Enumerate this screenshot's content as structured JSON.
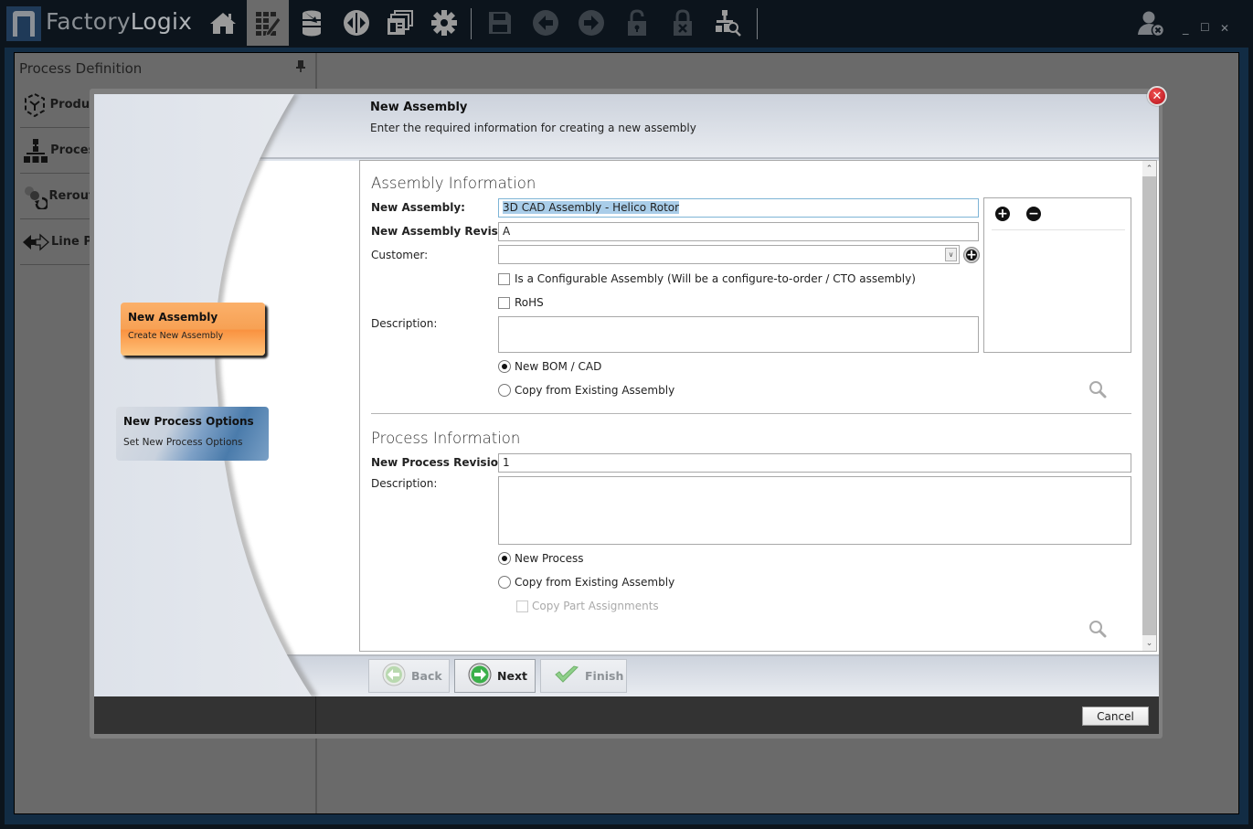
{
  "app": {
    "logo_text_plain": "Factory",
    "logo_text_bold": "Logix",
    "toolbar_icons": [
      {
        "name": "home-icon",
        "active": false,
        "enabled": true
      },
      {
        "name": "process-editor-grid-icon",
        "active": true,
        "enabled": true
      },
      {
        "name": "database-import-icon",
        "active": false,
        "enabled": true
      },
      {
        "name": "navigation-arrows-icon",
        "active": false,
        "enabled": true
      },
      {
        "name": "windows-icon",
        "active": false,
        "enabled": true
      },
      {
        "name": "gear-icon",
        "active": false,
        "enabled": true
      },
      {
        "name": "save-icon",
        "active": false,
        "enabled": false
      },
      {
        "name": "back-arrow-icon",
        "active": false,
        "enabled": false
      },
      {
        "name": "forward-arrow-icon",
        "active": false,
        "enabled": false
      },
      {
        "name": "unlock-icon",
        "active": false,
        "enabled": false
      },
      {
        "name": "lock-cancel-icon",
        "active": false,
        "enabled": false
      },
      {
        "name": "hierarchy-search-icon",
        "active": false,
        "enabled": true
      }
    ],
    "window_controls": {
      "minimize": "_",
      "maximize": "☐",
      "close": "✕"
    }
  },
  "process_definition": {
    "title": "Process Definition",
    "items": [
      {
        "label": "Product",
        "icon": "product-cube-icon"
      },
      {
        "label": "Process",
        "icon": "process-hierarchy-icon"
      },
      {
        "label": "Reroute",
        "icon": "reroute-icon"
      },
      {
        "label": "Line Pr",
        "icon": "line-arrows-icon"
      }
    ]
  },
  "dialog": {
    "header_title": "New Assembly",
    "header_subtitle": "Enter the required information for creating a new assembly",
    "steps": [
      {
        "title": "New Assembly",
        "subtitle": "Create New Assembly",
        "state": "active"
      },
      {
        "title": "New Process Options",
        "subtitle": "Set New Process Options",
        "state": "pending"
      }
    ],
    "assembly_section": {
      "title": "Assembly Information",
      "new_assembly_label": "New Assembly:",
      "new_assembly_value": "3D CAD Assembly - Helico Rotor",
      "revision_label": "New Assembly Revision:",
      "revision_value": "A",
      "customer_label": "Customer:",
      "customer_value": "",
      "configurable_label": "Is a Configurable Assembly (Will be a configure-to-order / CTO assembly)",
      "configurable_checked": false,
      "rohs_label": "RoHS",
      "rohs_checked": false,
      "description_label": "Description:",
      "description_value": "",
      "radio_options": [
        {
          "label": "New BOM / CAD",
          "selected": true
        },
        {
          "label": "Copy from Existing Assembly",
          "selected": false
        }
      ]
    },
    "process_section": {
      "title": "Process Information",
      "revision_label": "New Process Revision:",
      "revision_value": "1",
      "description_label": "Description:",
      "description_value": "",
      "radio_options": [
        {
          "label": "New Process",
          "selected": true
        },
        {
          "label": "Copy from Existing Assembly",
          "selected": false
        }
      ],
      "copy_part_label": "Copy Part Assignments",
      "copy_part_checked": false,
      "copy_part_enabled": false
    },
    "buttons": {
      "back": "Back",
      "next": "Next",
      "finish": "Finish",
      "cancel": "Cancel"
    }
  }
}
